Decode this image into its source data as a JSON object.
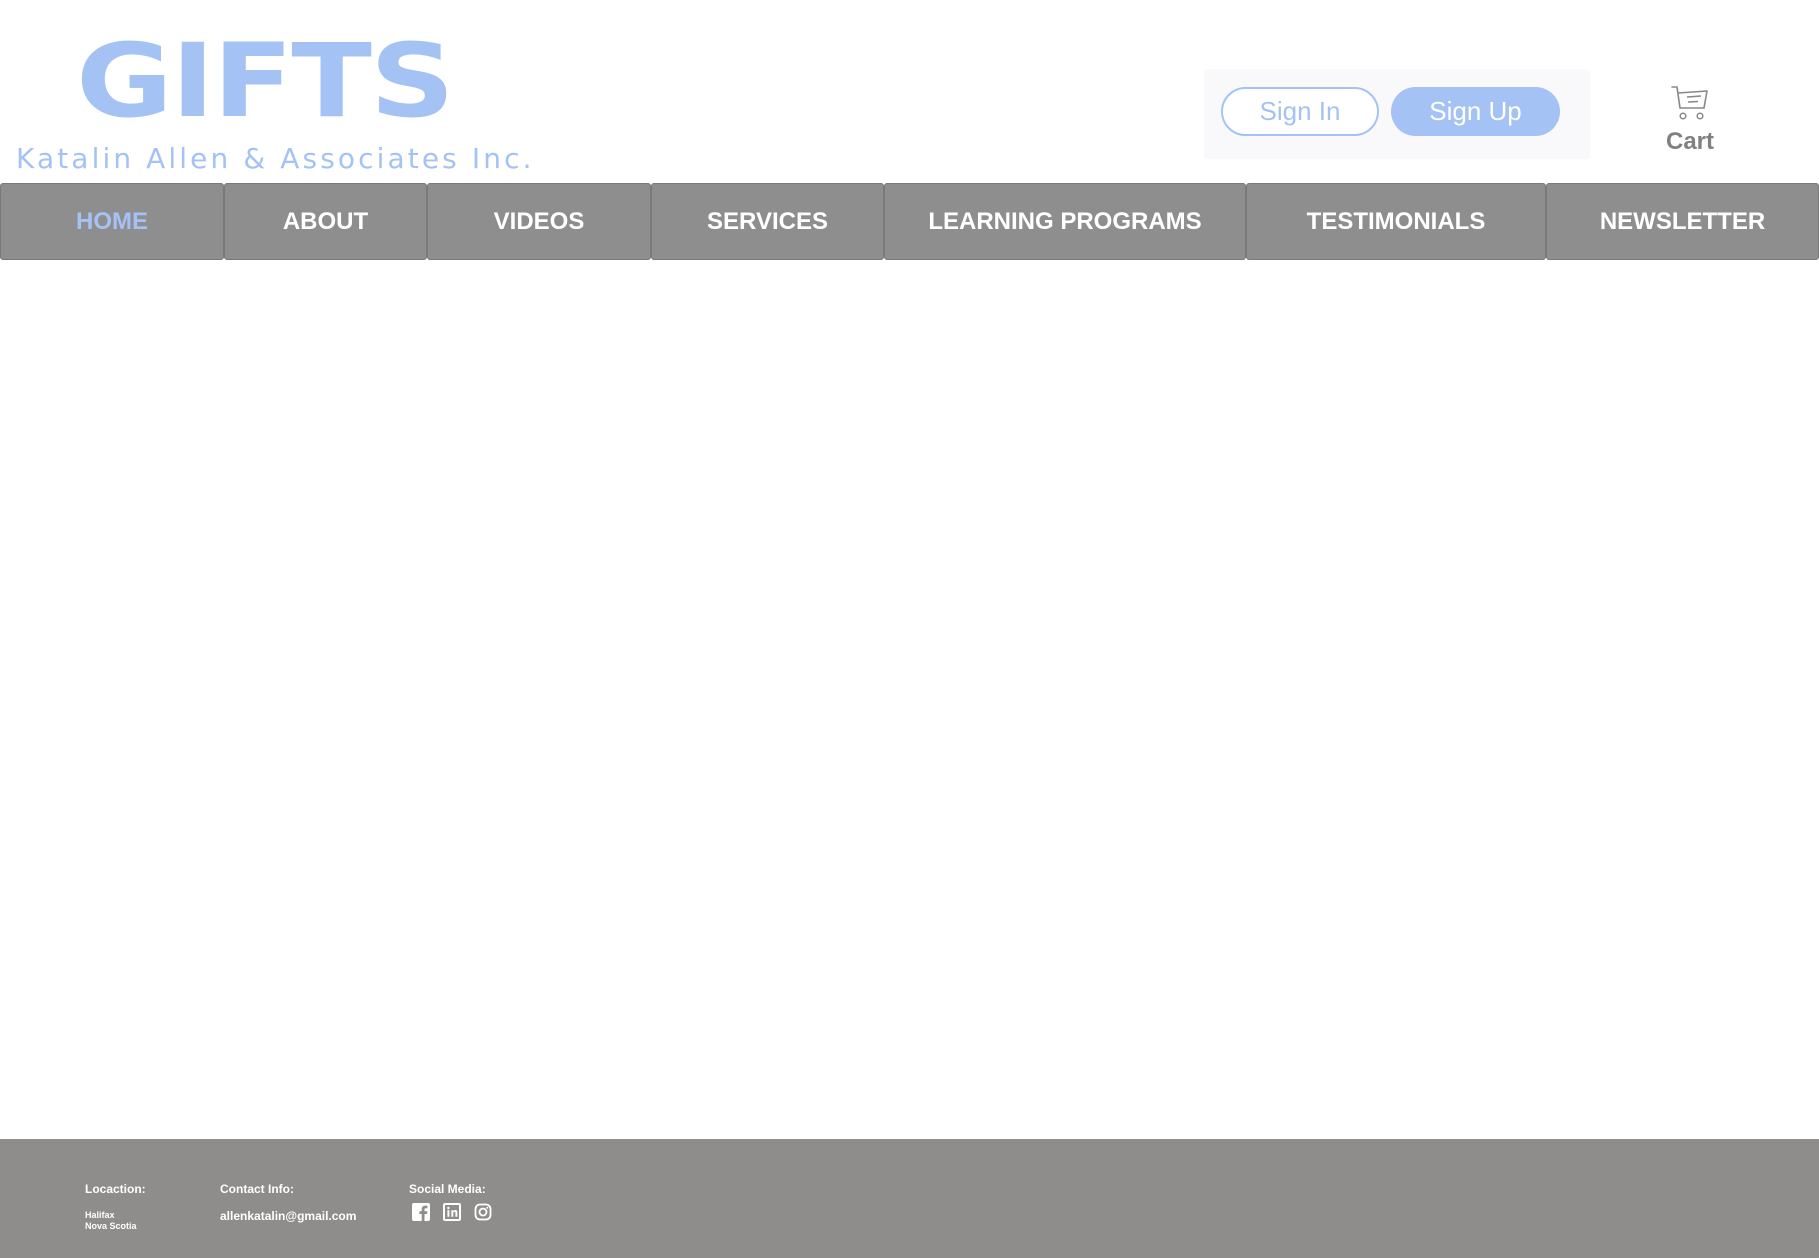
{
  "header": {
    "logo_main": "GIFTS",
    "logo_sub": "Katalin Allen & Associates Inc.",
    "sign_in_label": "Sign In",
    "sign_up_label": "Sign Up",
    "cart_label": "Cart",
    "cart_icon": "shopping-cart-icon"
  },
  "nav": {
    "items": [
      {
        "label": "HOME",
        "active": true
      },
      {
        "label": "ABOUT"
      },
      {
        "label": "VIDEOS"
      },
      {
        "label": "SERVICES"
      },
      {
        "label": "LEARNING PROGRAMS"
      },
      {
        "label": "TESTIMONIALS"
      },
      {
        "label": "NEWSLETTER"
      }
    ]
  },
  "footer": {
    "location_heading": "Locaction:",
    "location_city": "Halifax",
    "location_region": "Nova Scotia",
    "contact_heading": "Contact Info:",
    "contact_email": "allenkatalin@gmail.com",
    "social_heading": "Social Media:",
    "social_icons": [
      "facebook-icon",
      "linkedin-icon",
      "instagram-icon"
    ]
  },
  "colors": {
    "accent": "#a4c2f4",
    "nav_bg": "#8f8e8f",
    "footer_bg": "#8e8d8b",
    "cart_text": "#808080"
  }
}
